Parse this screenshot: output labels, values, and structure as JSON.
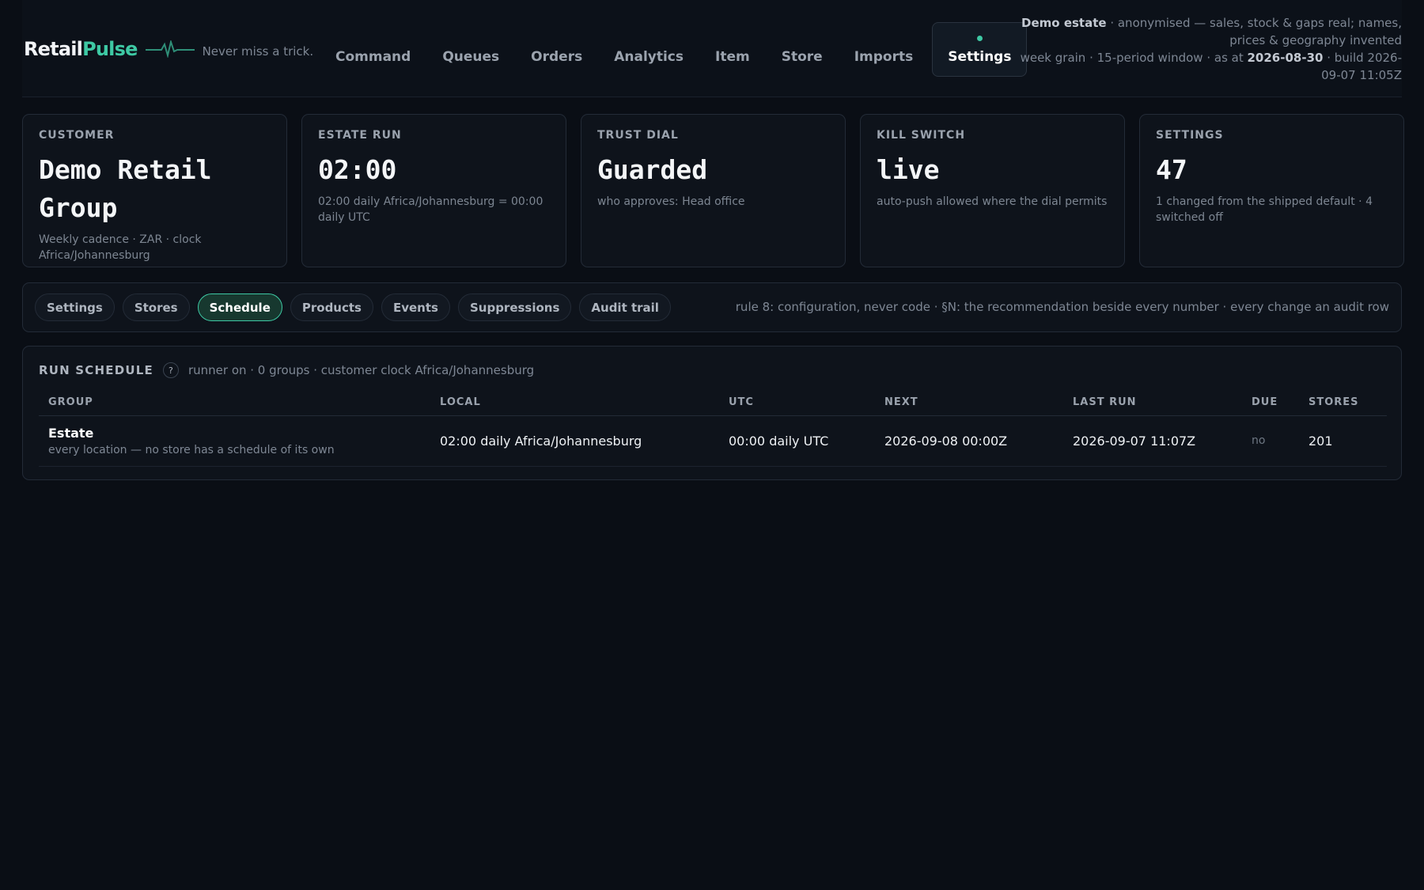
{
  "brand": {
    "name_a": "Retail",
    "name_b": "Pulse",
    "tagline": "Never miss a trick."
  },
  "nav": {
    "items": [
      "Command",
      "Queues",
      "Orders",
      "Analytics",
      "Item",
      "Store",
      "Imports"
    ],
    "active": "Settings"
  },
  "meta": {
    "estate": "Demo estate",
    "line1_rest": " · anonymised — sales, stock & gaps real; names, prices & geography invented",
    "line2_prefix": "week grain · 15-period window · as at ",
    "as_at": "2026-08-30",
    "line2_suffix": " · build 2026-09-07 11:05Z"
  },
  "kpis": [
    {
      "label": "CUSTOMER",
      "value": "Demo Retail Group",
      "sub": "Weekly cadence · ZAR · clock Africa/Johannesburg"
    },
    {
      "label": "ESTATE RUN",
      "value": "02:00",
      "sub": "02:00 daily Africa/Johannesburg = 00:00 daily UTC"
    },
    {
      "label": "TRUST DIAL",
      "value": "Guarded",
      "sub": "who approves: Head office"
    },
    {
      "label": "KILL SWITCH",
      "value": "live",
      "sub": "auto-push allowed where the dial permits"
    },
    {
      "label": "SETTINGS",
      "value": "47",
      "sub": "1 changed from the shipped default · 4 switched off"
    }
  ],
  "subnav": {
    "tabs": [
      "Settings",
      "Stores",
      "Schedule",
      "Products",
      "Events",
      "Suppressions",
      "Audit trail"
    ],
    "note": "rule 8: configuration, never code · §N: the recommendation beside every number · every change an audit row"
  },
  "schedule": {
    "title": "RUN SCHEDULE",
    "help": "?",
    "sub": "runner on · 0 groups · customer clock Africa/Johannesburg",
    "columns": [
      "GROUP",
      "LOCAL",
      "UTC",
      "NEXT",
      "LAST RUN",
      "DUE",
      "STORES"
    ],
    "rows": [
      {
        "group": "Estate",
        "group_sub": "every location — no store has a schedule of its own",
        "local": "02:00 daily Africa/Johannesburg",
        "utc": "00:00 daily UTC",
        "next": "2026-09-08 00:00Z",
        "last_run": "2026-09-07 11:07Z",
        "due": "no",
        "stores": "201"
      }
    ]
  }
}
